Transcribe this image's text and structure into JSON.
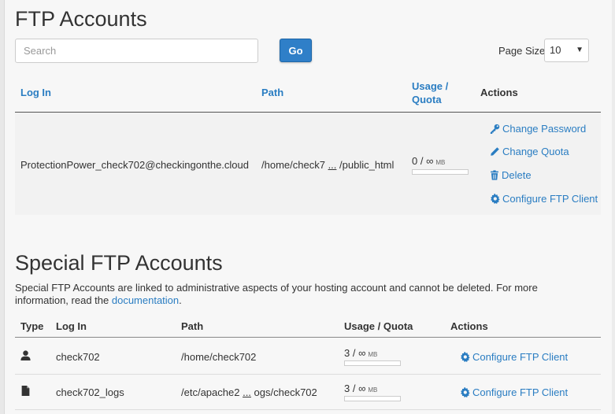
{
  "ftp": {
    "title": "FTP Accounts",
    "search_placeholder": "Search",
    "go_label": "Go",
    "page_size_label": "Page Size",
    "page_size_value": "10",
    "columns": {
      "login": "Log In",
      "path": "Path",
      "usage": "Usage /",
      "quota": "Quota",
      "actions": "Actions"
    },
    "rows": [
      {
        "login": "ProtectionPower_check702@checkingonthe.cloud",
        "path_start": "/home/check7",
        "path_ellipsis": "...",
        "path_end": "/public_html",
        "usage": "0 / ∞",
        "unit": "MB",
        "usage_fraction": 0,
        "actions": {
          "change_password": "Change Password",
          "change_quota": "Change Quota",
          "delete": "Delete",
          "configure": "Configure FTP Client"
        }
      }
    ]
  },
  "special": {
    "title": "Special FTP Accounts",
    "description": "Special FTP Accounts are linked to administrative aspects of your hosting account and cannot be deleted. For more information, read the",
    "doc_link": "documentation",
    "doc_suffix": ".",
    "columns": {
      "type": "Type",
      "login": "Log In",
      "path": "Path",
      "usage": "Usage / Quota",
      "actions": "Actions"
    },
    "rows": [
      {
        "type_icon": "user-icon",
        "login": "check702",
        "path": "/home/check702",
        "usage": "3 / ∞",
        "unit": "MB",
        "usage_fraction": 0,
        "action": "Configure FTP Client"
      },
      {
        "type_icon": "file-icon",
        "login": "check702_logs",
        "path_start": "/etc/apache2",
        "path_ellipsis": "...",
        "path_end": "ogs/check702",
        "usage": "3 / ∞",
        "unit": "MB",
        "usage_fraction": 0,
        "action": "Configure FTP Client"
      }
    ]
  },
  "colors": {
    "accent": "#2a7dc2",
    "button": "#2f7fc8"
  }
}
